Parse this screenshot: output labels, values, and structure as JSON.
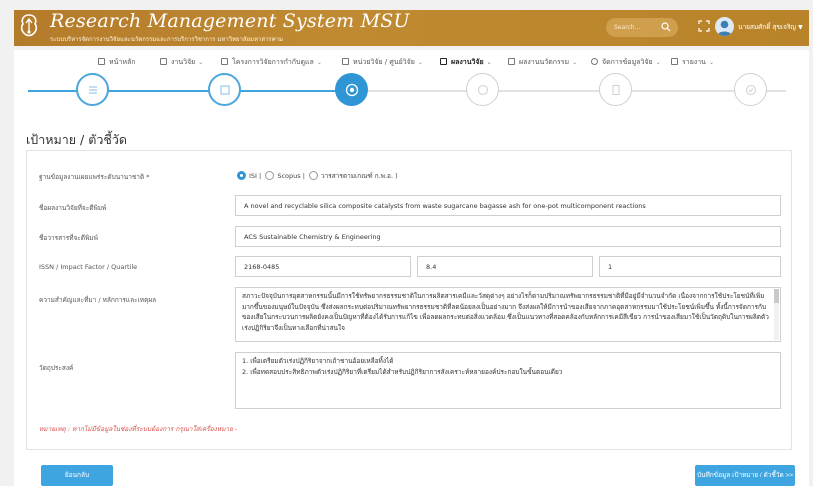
{
  "header": {
    "title": "Research Management System MSU",
    "subtitle": "ระบบบริหารจัดการงานวิจัยและนวัตกรรมและการบริการวิชาการ มหาวิทยาลัยมหาสารคาม",
    "search_placeholder": "Search...",
    "user_name": "นายสมศักดิ์ สุขเจริญ",
    "brand_color": "#b47b2a"
  },
  "nav": {
    "items": [
      {
        "label": "หน้าหลัก",
        "icon": "home-icon",
        "has_menu": false
      },
      {
        "label": "งานวิจัย",
        "icon": "list-icon",
        "has_menu": true
      },
      {
        "label": "โครงการวิจัยการกำกับดูแล",
        "icon": "folder-icon",
        "has_menu": true
      },
      {
        "label": "หน่วยวิจัย / ศูนย์วิจัย",
        "icon": "building-icon",
        "has_menu": true
      },
      {
        "label": "ผลงานวิจัย",
        "icon": "flask-icon",
        "has_menu": true,
        "active": true
      },
      {
        "label": "ผลงานนวัตกรรม",
        "icon": "bulb-icon",
        "has_menu": true
      },
      {
        "label": "จัดการข้อมูลวิจัย",
        "icon": "gear-icon",
        "has_menu": true
      },
      {
        "label": "รายงาน",
        "icon": "report-icon",
        "has_menu": true
      }
    ]
  },
  "stepper": {
    "steps": [
      {
        "icon": "list-icon",
        "state": "done"
      },
      {
        "icon": "folder-icon",
        "state": "done"
      },
      {
        "icon": "target-icon",
        "state": "current"
      },
      {
        "icon": "coin-icon",
        "state": "todo"
      },
      {
        "icon": "document-icon",
        "state": "todo"
      },
      {
        "icon": "check-icon",
        "state": "todo"
      }
    ],
    "accent_color": "#2f95d5"
  },
  "form": {
    "section_title": "เป้าหมาย / ตัวชี้วัด",
    "fields": {
      "database": {
        "label": "ฐานข้อมูลงานเผยแพร่ระดับนานาชาติ *",
        "options": [
          "ISI",
          "Scopus",
          "วารสารตามเกณฑ์ ก.พ.อ."
        ],
        "selected": "ISI",
        "separators": [
          "|",
          "|",
          ")"
        ]
      },
      "article_title": {
        "label": "ชื่อผลงานวิจัยที่จะตีพิมพ์",
        "value": "A novel and recyclable silica composite catalysts from waste sugarcane bagasse ash for one-pot multicomponent reactions"
      },
      "journal_name": {
        "label": "ชื่อวารสารที่จะตีพิมพ์",
        "value": "ACS Sustainable Chemistry & Engineering"
      },
      "issn": {
        "label": "ISSN / Impact Factor / Quartile",
        "issn": "2168-0485",
        "impact_factor": "8.4",
        "quartile": "1"
      },
      "importance": {
        "label": "ความสำคัญและที่มา / หลักการและเหตุผล",
        "value": "สภาวะปัจจุบันการอุตสาหกรรมนั้นมีการใช้ทรัพยากรธรรมชาติในการผลิตสารเคมีและวัสดุต่างๆ อย่างไรก็ตามปริมาณทรัพยากรธรรมชาติที่มีอยู่มีจำนวนจำกัด เนื่องจากการใช้ประโยชน์ที่เพิ่มมากขึ้นของมนุษย์ในปัจจุบัน ซึ่งส่งผลกระทบต่อปริมาณทรัพยากรธรรมชาติที่ลดน้อยลงเป็นอย่างมาก จึงส่งผลให้มีการนำของเสียจากภาคอุตสาหกรรมมาใช้ประโยชน์เพิ่มขึ้น ทั้งนี้การจัดการกับของเสียในกระบวนการผลิตยังคงเป็นปัญหาที่ต้องได้รับการแก้ไข เพื่อลดผลกระทบต่อสิ่งแวดล้อม ซึ่งเป็นแนวทางที่สอดคล้องกับหลักการเคมีสีเขียว การนำของเสียมาใช้เป็นวัตถุดิบในการผลิตตัวเร่งปฏิกิริยาจึงเป็นทางเลือกที่น่าสนใจ"
      },
      "objectives": {
        "label": "วัตถุประสงค์",
        "lines": [
          "1. เพื่อเตรียมตัวเร่งปฏิกิริยาจากเถ้าชานอ้อยเหลือทิ้งได้",
          "2. เพื่อทดสอบประสิทธิภาพตัวเร่งปฏิกิริยาที่เตรียมได้สำหรับปฏิกิริยาการสังเคราะห์หลายองค์ประกอบในขั้นตอนเดียว"
        ]
      }
    },
    "note": "หมายเหตุ : หากไม่มีข้อมูลในช่องที่ระบบต้องการ กรุณาใส่เครื่องหมาย -",
    "buttons": {
      "back": "ย้อนกลับ",
      "save": "บันทึกข้อมูล เป้าหมาย / ตัวชี้วัด >>"
    }
  }
}
